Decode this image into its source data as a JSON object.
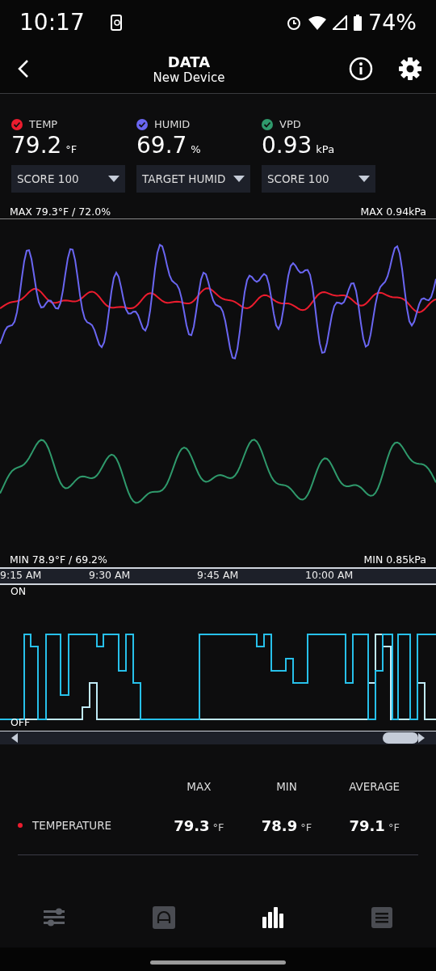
{
  "status_bar": {
    "time": "10:17",
    "battery": "74%"
  },
  "header": {
    "title": "DATA",
    "subtitle": "New Device"
  },
  "sensors": [
    {
      "label": "TEMP",
      "value": "79.2",
      "unit": "°F",
      "color": "#ec1c2e",
      "dropdown": "SCORE 100"
    },
    {
      "label": "HUMID",
      "value": "69.7",
      "unit": "%",
      "color": "#6a66f2",
      "dropdown": "TARGET HUMID"
    },
    {
      "label": "VPD",
      "value": "0.93",
      "unit": "kPa",
      "color": "#2f9a6c",
      "dropdown": "SCORE 100"
    }
  ],
  "chart": {
    "max_left": "MAX 79.3°F / 72.0%",
    "max_right": "MAX 0.94kPa",
    "min_left": "MIN 78.9°F / 69.2%",
    "min_right": "MIN 0.85kPa",
    "times": [
      "9:15 AM",
      "9:30 AM",
      "9:45 AM",
      "10:00 AM"
    ]
  },
  "switch_chart": {
    "on_label": "ON",
    "off_label": "OFF"
  },
  "summary": {
    "columns": [
      "MAX",
      "MIN",
      "AVERAGE"
    ],
    "rows": [
      {
        "name": "TEMPERATURE",
        "color": "#ec1c2e",
        "values": [
          {
            "value": "79.3",
            "unit": "°F"
          },
          {
            "value": "78.9",
            "unit": "°F"
          },
          {
            "value": "79.1",
            "unit": "°F"
          }
        ]
      }
    ]
  },
  "nav": [
    {
      "kind": "sliders",
      "selected": false
    },
    {
      "kind": "arch",
      "selected": false
    },
    {
      "kind": "bars",
      "selected": true
    },
    {
      "kind": "list",
      "selected": false
    }
  ]
}
